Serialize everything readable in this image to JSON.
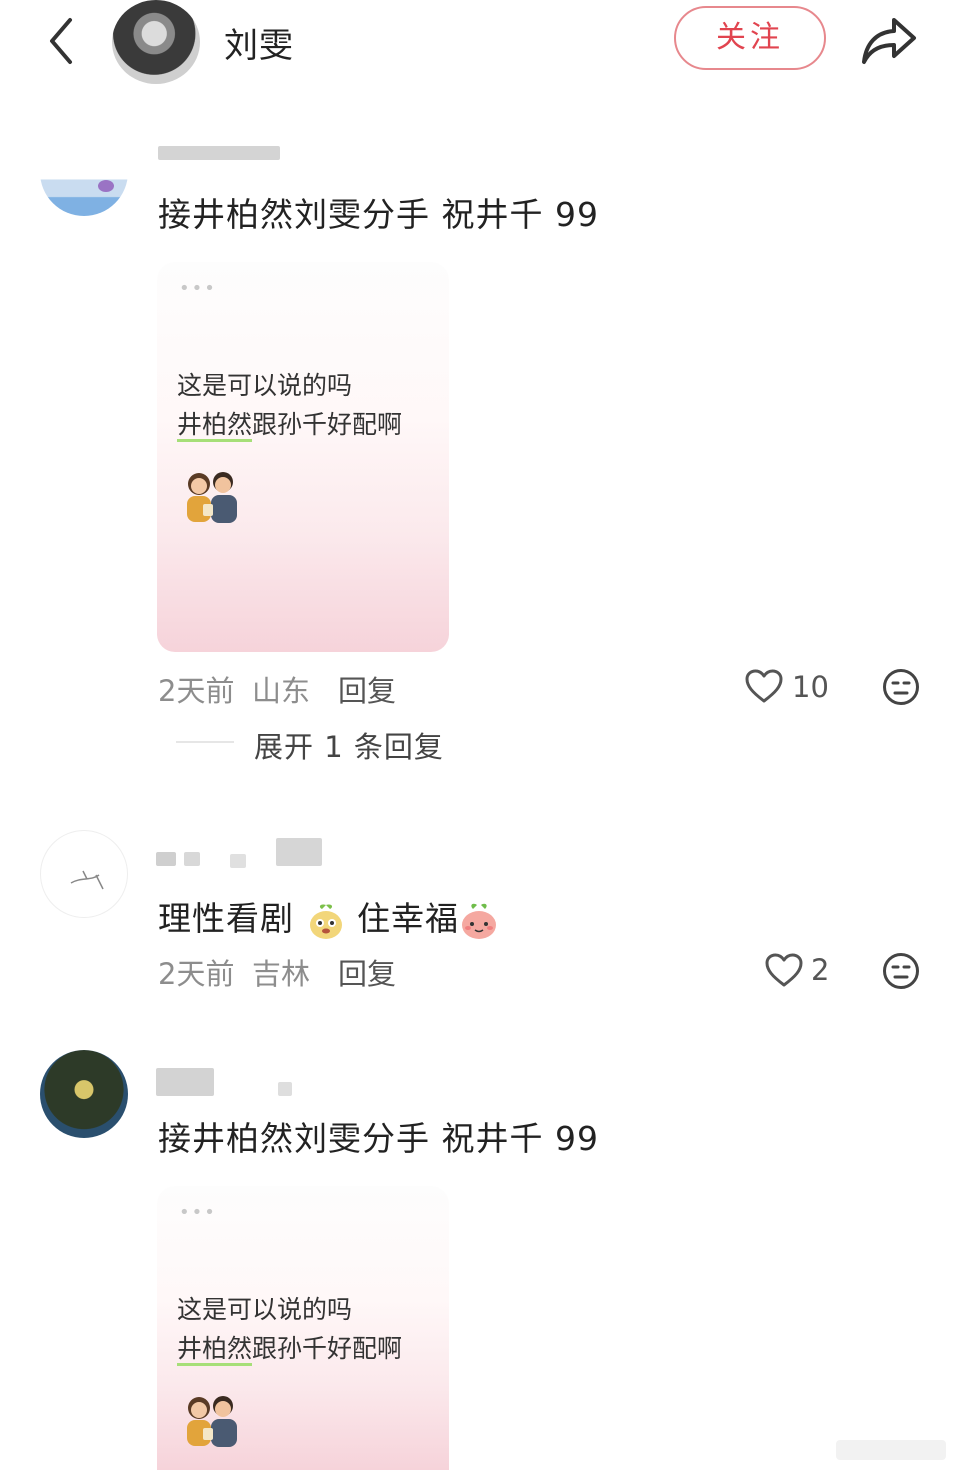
{
  "header": {
    "author_name": "刘雯",
    "follow_label": "关注"
  },
  "comments": [
    {
      "text": "接井柏然刘雯分手 祝井千 99",
      "image_card": {
        "line1": "这是可以说的吗",
        "line2_highlight": "井柏然",
        "line2_rest": "跟孙千好配啊"
      },
      "time": "2天前",
      "location": "山东",
      "reply_label": "回复",
      "likes": "10",
      "expand_label": "展开 1 条回复"
    },
    {
      "text_part1": "理性看剧",
      "text_part2": "住幸福",
      "time": "2天前",
      "location": "吉林",
      "reply_label": "回复",
      "likes": "2"
    },
    {
      "text": "接井柏然刘雯分手 祝井千 99",
      "image_card": {
        "line1": "这是可以说的吗",
        "line2_highlight": "井柏然",
        "line2_rest": "跟孙千好配啊"
      }
    }
  ],
  "icons": {
    "back": "chevron-left-icon",
    "share": "share-arrow-icon",
    "like": "heart-outline-icon",
    "dislike": "neutral-face-icon"
  },
  "colors": {
    "accent": "#e1444f",
    "follow_border": "#e7888d",
    "highlight_underline": "#a6df78"
  }
}
